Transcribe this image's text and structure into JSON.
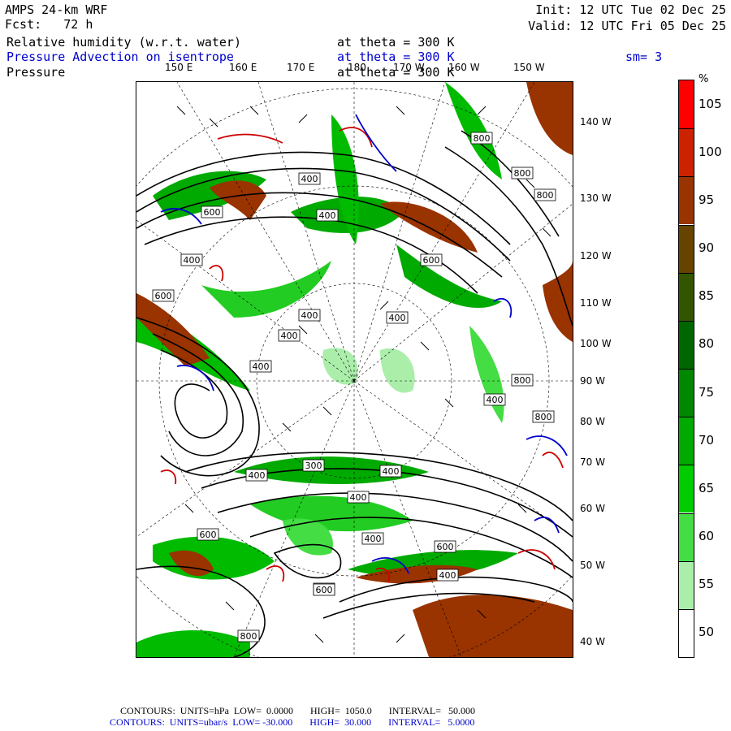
{
  "header": {
    "model": "AMPS 24-km WRF",
    "fcst": "Fcst:   72 h",
    "init": "Init: 12 UTC Tue 02 Dec 25",
    "valid": "Valid: 12 UTC Fri 05 Dec 25",
    "field1": "Relative humidity (w.r.t. water)",
    "field1_level": "at theta = 300 K",
    "field2": "Pressure Advection on isentrope",
    "field2_level": "at theta = 300 K",
    "smooth": "sm= 3",
    "field3": "Pressure",
    "field3_level": "at theta = 300 K"
  },
  "map": {
    "top_lon_labels": [
      "150 E",
      "160 E",
      "170 E",
      "180",
      "170 W",
      "160 W",
      "150 W"
    ],
    "right_lon_labels": [
      "140 W",
      "130 W",
      "120 W",
      "110 W",
      "100 W",
      "90 W",
      "80 W",
      "70 W",
      "60 W",
      "50 W",
      "40 W"
    ],
    "contour_tags": [
      "800",
      "800",
      "800",
      "600",
      "600",
      "600",
      "400",
      "400",
      "400",
      "400",
      "400",
      "400",
      "400",
      "800",
      "400",
      "800",
      "400",
      "300",
      "400",
      "400",
      "400",
      "600",
      "400",
      "400",
      "600",
      "600",
      "800"
    ],
    "colors": {
      "contour": "#000000",
      "advection_pos": "#cc0000",
      "advection_neg": "#0000cc"
    }
  },
  "colorbar": {
    "unit": "%",
    "labels": [
      "105",
      "100",
      "95",
      "90",
      "85",
      "80",
      "75",
      "70",
      "65",
      "60",
      "55",
      "50"
    ],
    "colors": [
      "#ff0000",
      "#cc2200",
      "#993300",
      "#664400",
      "#335500",
      "#006600",
      "#008800",
      "#00aa00",
      "#00cc00",
      "#44dd44",
      "#aaeeaa",
      "#ffffff"
    ]
  },
  "footer": {
    "line1": "CONTOURS:  UNITS=hPa  LOW=  0.0000       HIGH=  1050.0       INTERVAL=   50.000",
    "line2": "CONTOURS:  UNITS=ubar/s  LOW= -30.000       HIGH=  30.000       INTERVAL=   5.0000"
  }
}
